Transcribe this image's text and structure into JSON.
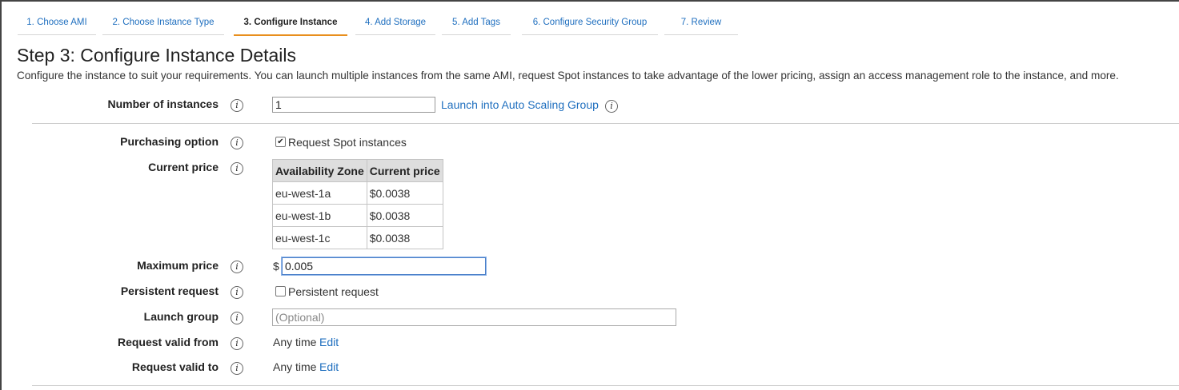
{
  "tabs": [
    {
      "label": "1. Choose AMI"
    },
    {
      "label": "2. Choose Instance Type"
    },
    {
      "label": "3. Configure Instance"
    },
    {
      "label": "4. Add Storage"
    },
    {
      "label": "5. Add Tags"
    },
    {
      "label": "6. Configure Security Group"
    },
    {
      "label": "7. Review"
    }
  ],
  "page": {
    "title": "Step 3: Configure Instance Details",
    "description": "Configure the instance to suit your requirements. You can launch multiple instances from the same AMI, request Spot instances to take advantage of the lower pricing, assign an access management role to the instance, and more."
  },
  "form": {
    "number_of_instances": {
      "label": "Number of instances",
      "value": "1",
      "link": "Launch into Auto Scaling Group"
    },
    "purchasing_option": {
      "label": "Purchasing option",
      "checkbox_label": "Request Spot instances",
      "checked": true
    },
    "current_price": {
      "label": "Current price",
      "headers": [
        "Availability Zone",
        "Current price"
      ],
      "rows": [
        [
          "eu-west-1a",
          "$0.0038"
        ],
        [
          "eu-west-1b",
          "$0.0038"
        ],
        [
          "eu-west-1c",
          "$0.0038"
        ]
      ]
    },
    "maximum_price": {
      "label": "Maximum price",
      "currency": "$",
      "value": "0.005"
    },
    "persistent_request": {
      "label": "Persistent request",
      "checkbox_label": "Persistent request",
      "checked": false
    },
    "launch_group": {
      "label": "Launch group",
      "placeholder": "(Optional)"
    },
    "request_valid_from": {
      "label": "Request valid from",
      "value": "Any time",
      "edit": "Edit"
    },
    "request_valid_to": {
      "label": "Request valid to",
      "value": "Any time",
      "edit": "Edit"
    }
  },
  "icons": {
    "info": "i",
    "check": "✔"
  },
  "colors": {
    "accent": "#e88f1e",
    "link": "#1f6fbf"
  }
}
